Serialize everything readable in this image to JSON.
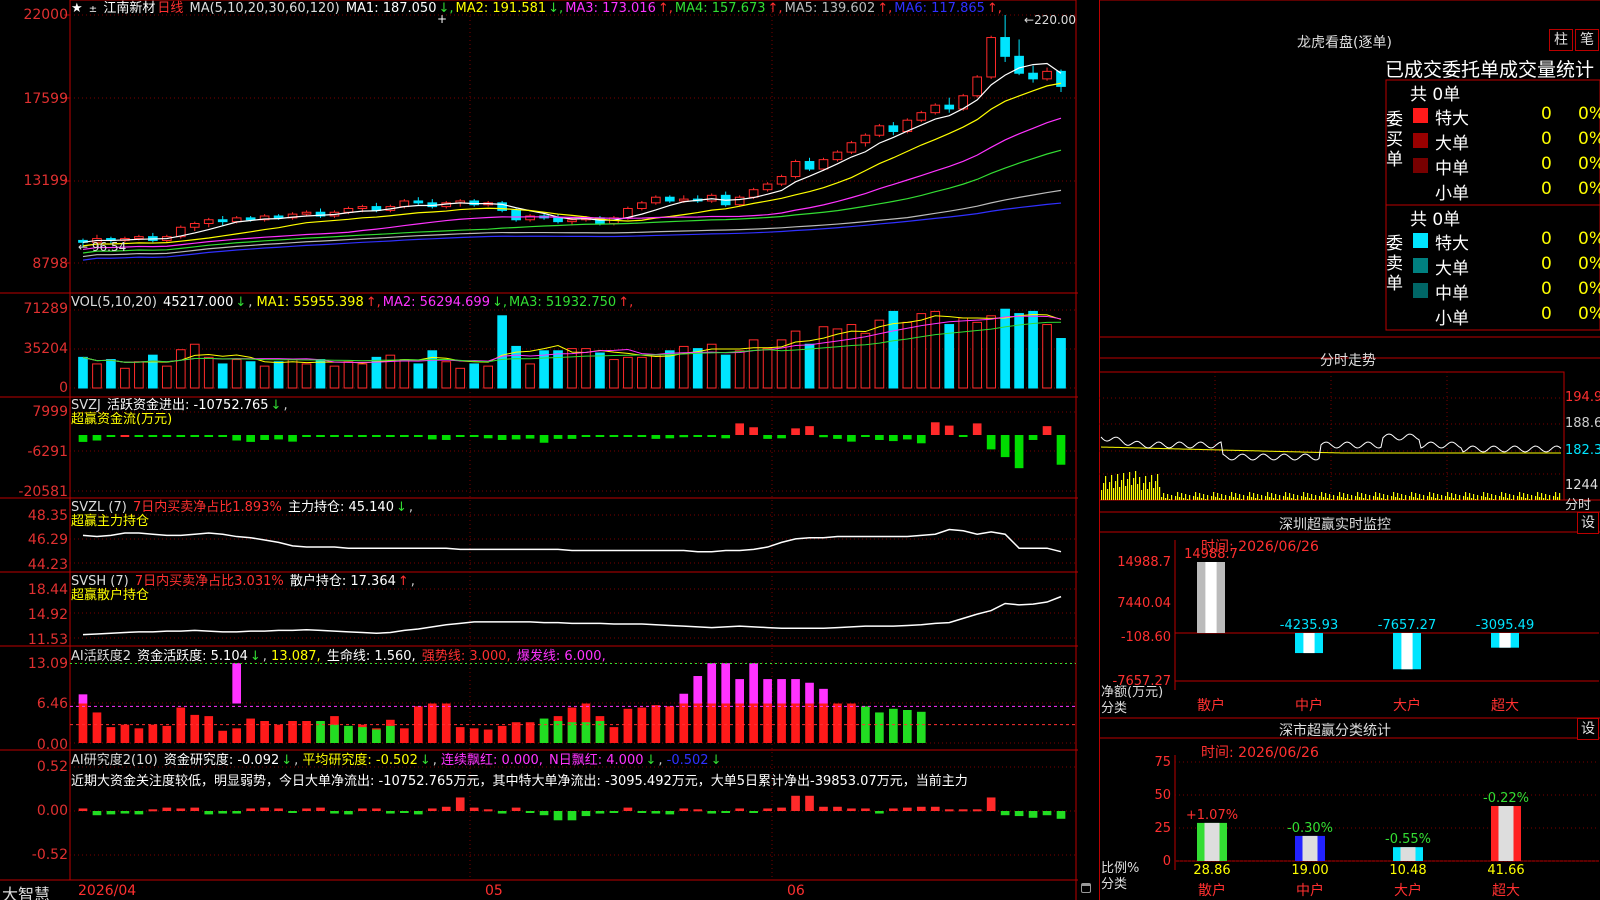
{
  "stock": {
    "name": "江南新材",
    "period": "日线"
  },
  "colors": {
    "up": "#ff2a2a",
    "down": "#00e5ff",
    "grid": "#7a0000",
    "ma1": "#ffffff",
    "ma2": "#ffff00",
    "ma3": "#ff33ff",
    "ma4": "#33dd33",
    "ma5": "#bbbbbb",
    "ma6": "#3030ff"
  },
  "main_panel": {
    "ma_label": "MA(5,10,20,30,60,120)",
    "mas": [
      {
        "label": "MA1: 187.050",
        "arrow": "↓",
        "color": "#ffffff"
      },
      {
        "label": "MA2: 191.581",
        "arrow": "↓",
        "color": "#ffff00"
      },
      {
        "label": "MA3: 173.016",
        "arrow": "↑",
        "color": "#ff33ff"
      },
      {
        "label": "MA4: 157.673",
        "arrow": "↑",
        "color": "#33dd33"
      },
      {
        "label": "MA5: 139.602",
        "arrow": "↑",
        "color": "#bbbbbb"
      },
      {
        "label": "MA6: 117.865",
        "arrow": "↑",
        "color": "#3030ff"
      }
    ],
    "yticks": [
      "22000",
      "17599",
      "13199",
      "8798"
    ],
    "hi_label": "220.00",
    "lo_label": "96.54"
  },
  "vol_panel": {
    "label": "VOL(5,10,20)",
    "value": "45217.000",
    "arrow": "↓",
    "mas": [
      {
        "label": "MA1: 55955.398",
        "arrow": "↑",
        "color": "#ffff00"
      },
      {
        "label": "MA2: 56294.699",
        "arrow": "↓",
        "color": "#ff33ff"
      },
      {
        "label": "MA3: 51932.750",
        "arrow": "↑",
        "color": "#33dd33"
      }
    ],
    "yticks": [
      "71289",
      "35204",
      "0"
    ]
  },
  "svzj_panel": {
    "label": "SVZJ",
    "subtitle": "活跃资金进出: -10752.765",
    "arrow": "↓",
    "subtitle2": "超赢资金流(万元)",
    "yticks": [
      "7999",
      "-6291",
      "-20581"
    ]
  },
  "svzl_panel": {
    "label": "SVZL (7)",
    "part1": "7日内买卖净占比1.893%",
    "part2": "主力持仓: 45.140",
    "arrow": "↓",
    "subtitle2": "超赢主力持仓",
    "yticks": [
      "48.35",
      "46.29",
      "44.23"
    ]
  },
  "svsh_panel": {
    "label": "SVSH (7)",
    "part1": "7日内买卖净占比3.031%",
    "part2": "散户持仓: 17.364",
    "arrow": "↑",
    "subtitle2": "超赢散户持仓",
    "yticks": [
      "18.44",
      "14.92",
      "11.53"
    ]
  },
  "ai1_panel": {
    "label": "AI活跃度2",
    "part1": "资金活跃度: 5.104",
    "arrow1": "↓",
    "part2": "13.087,",
    "part3": "生命线: 1.560,",
    "part4": "强势线: 3.000,",
    "part5": "爆发线: 6.000,",
    "yticks": [
      "13.09",
      "6.46",
      "0.00"
    ]
  },
  "ai2_panel": {
    "label": "AI研究度2(10)",
    "part1": "资金研究度: -0.092",
    "arrow1": "↓",
    "part2": "平均研究度: -0.502",
    "arrow2": "↓",
    "part3": "连续飘红: 0.000,",
    "part4": "N日飘红: 4.000",
    "arrow4": "↓",
    "part5": "-0.502",
    "arrow5": "↓",
    "desc": "近期大资金关注度较低，明显弱势，今日大单净流出: -10752.765万元，其中特大单净流出: -3095.492万元，大单5日累计净出-39853.07万元，当前主力",
    "yticks": [
      "0.52",
      "0.00",
      "-0.52"
    ]
  },
  "xaxis": {
    "labels": [
      "2026/04",
      "05",
      "06"
    ]
  },
  "brand": "大智慧",
  "right": {
    "lhb_title": "龙虎看盘(逐单)",
    "btn_zhu": "柱",
    "btn_bi": "笔",
    "tabs": "已成交委托单成交量统计",
    "buy_label": "委买单",
    "sell_label": "委卖单",
    "buy_total": "共 0单",
    "sell_total": "共 0单",
    "buy_rows": [
      {
        "name": "特大",
        "count": "0",
        "pct": "0%",
        "color": "#ff1a1a"
      },
      {
        "name": "大单",
        "count": "0",
        "pct": "0%",
        "color": "#990000"
      },
      {
        "name": "中单",
        "count": "0",
        "pct": "0%",
        "color": "#770000"
      },
      {
        "name": "小单",
        "count": "0",
        "pct": "0%",
        "color": ""
      }
    ],
    "sell_rows": [
      {
        "name": "特大",
        "count": "0",
        "pct": "0%",
        "color": "#00e5ff"
      },
      {
        "name": "大单",
        "count": "0",
        "pct": "0%",
        "color": "#008080"
      },
      {
        "name": "中单",
        "count": "0",
        "pct": "0%",
        "color": "#006666"
      },
      {
        "name": "小单",
        "count": "0",
        "pct": "0%",
        "color": ""
      }
    ],
    "fs_title": "分时走势",
    "fs_yticks": [
      "194.9",
      "188.6",
      "182.3",
      "1244"
    ],
    "fs_fenshi": "分时",
    "mon_title": "深圳超赢实时监控",
    "mon_btn": "设",
    "mon_time": "时间: 2026/06/26",
    "mon_yticks": [
      "14988.7",
      "7440.04",
      "-108.60",
      "-7657.27"
    ],
    "mon_ylabel": "净额(万元)",
    "mon_xlabel": "分类",
    "mon_bars": [
      {
        "cat": "散户",
        "value": 14988.7,
        "label": "14988.7"
      },
      {
        "cat": "中户",
        "value": -4235.93,
        "label": "-4235.93"
      },
      {
        "cat": "大户",
        "value": -7657.27,
        "label": "-7657.27"
      },
      {
        "cat": "超大",
        "value": -3095.49,
        "label": "-3095.49"
      }
    ],
    "cls_title": "深市超赢分类统计",
    "cls_btn": "设",
    "cls_time": "时间: 2026/06/26",
    "cls_yticks": [
      "75",
      "50",
      "25",
      "0"
    ],
    "cls_ylabel": "比例%",
    "cls_xlabel": "分类",
    "cls_bars": [
      {
        "cat": "散户",
        "value": 28.86,
        "label": "28.86",
        "delta": "+1.07%",
        "color": "#33dd33"
      },
      {
        "cat": "中户",
        "value": 19.0,
        "label": "19.00",
        "delta": "-0.30%",
        "color": "#2222ff"
      },
      {
        "cat": "大户",
        "value": 10.48,
        "label": "10.48",
        "delta": "-0.55%",
        "color": "#00e5ff"
      },
      {
        "cat": "超大",
        "value": 41.66,
        "label": "41.66",
        "delta": "-0.22%",
        "color": "#ff2222"
      }
    ]
  },
  "chart_data": {
    "type": "candlestick",
    "title": "江南新材 日线",
    "x_range": [
      "2026/04",
      "2026/06/26"
    ],
    "ylim": [
      87.98,
      220.0
    ],
    "ohlc": [
      [
        100,
        101,
        96.5,
        99
      ],
      [
        99,
        103,
        97,
        101
      ],
      [
        101,
        102,
        98,
        100
      ],
      [
        100,
        102,
        99,
        101
      ],
      [
        101,
        103,
        100,
        102
      ],
      [
        102,
        104,
        99,
        100
      ],
      [
        100,
        103,
        99,
        102
      ],
      [
        102,
        108,
        101,
        107
      ],
      [
        107,
        110,
        105,
        109
      ],
      [
        109,
        112,
        107,
        111
      ],
      [
        111,
        113,
        108,
        110
      ],
      [
        110,
        113,
        109,
        112
      ],
      [
        112,
        113,
        110,
        111
      ],
      [
        111,
        114,
        110,
        113
      ],
      [
        113,
        114,
        111,
        112
      ],
      [
        112,
        115,
        111,
        114
      ],
      [
        114,
        116,
        113,
        115
      ],
      [
        115,
        117,
        112,
        113
      ],
      [
        113,
        116,
        112,
        115
      ],
      [
        115,
        118,
        114,
        117
      ],
      [
        117,
        119,
        115,
        118
      ],
      [
        118,
        120,
        115,
        116
      ],
      [
        116,
        119,
        115,
        118
      ],
      [
        118,
        122,
        117,
        121
      ],
      [
        121,
        123,
        119,
        120
      ],
      [
        120,
        122,
        117,
        118
      ],
      [
        118,
        121,
        117,
        120
      ],
      [
        120,
        122,
        118,
        121
      ],
      [
        121,
        122,
        118,
        119
      ],
      [
        119,
        121,
        118,
        120
      ],
      [
        120,
        121,
        115,
        116
      ],
      [
        116,
        117,
        110,
        111
      ],
      [
        111,
        114,
        110,
        113
      ],
      [
        113,
        115,
        111,
        112
      ],
      [
        112,
        114,
        109,
        110
      ],
      [
        110,
        112,
        108,
        111
      ],
      [
        111,
        113,
        110,
        112
      ],
      [
        112,
        113,
        108,
        109
      ],
      [
        109,
        113,
        108,
        112
      ],
      [
        112,
        118,
        111,
        117
      ],
      [
        117,
        121,
        116,
        120
      ],
      [
        120,
        124,
        119,
        123
      ],
      [
        123,
        124,
        120,
        121
      ],
      [
        121,
        124,
        120,
        122
      ],
      [
        122,
        124,
        120,
        121
      ],
      [
        121,
        125,
        120,
        124
      ],
      [
        124,
        126,
        118,
        119
      ],
      [
        119,
        124,
        118,
        123
      ],
      [
        123,
        128,
        122,
        127
      ],
      [
        127,
        131,
        126,
        130
      ],
      [
        130,
        135,
        129,
        134
      ],
      [
        134,
        143,
        133,
        142
      ],
      [
        142,
        144,
        137,
        138
      ],
      [
        138,
        144,
        137,
        143
      ],
      [
        143,
        148,
        142,
        147
      ],
      [
        147,
        153,
        146,
        152
      ],
      [
        152,
        157,
        150,
        156
      ],
      [
        156,
        162,
        155,
        161
      ],
      [
        161,
        163,
        156,
        158
      ],
      [
        158,
        165,
        157,
        164
      ],
      [
        164,
        169,
        163,
        168
      ],
      [
        168,
        173,
        167,
        172
      ],
      [
        172,
        176,
        168,
        170
      ],
      [
        170,
        178,
        169,
        177
      ],
      [
        177,
        188,
        176,
        187
      ],
      [
        187,
        209,
        186,
        208
      ],
      [
        208,
        220,
        195,
        198
      ],
      [
        198,
        207,
        188,
        189
      ],
      [
        189,
        193,
        184,
        186
      ],
      [
        186,
        192,
        185,
        190
      ],
      [
        190,
        191,
        179,
        182
      ]
    ],
    "ma_series": {
      "MA1": [
        187.05
      ],
      "MA2": [
        191.581
      ],
      "MA3": [
        173.016
      ],
      "MA4": [
        157.673
      ],
      "MA5": [
        139.602
      ],
      "MA6": [
        117.865
      ]
    },
    "volume": [
      28000,
      22000,
      26000,
      18000,
      24000,
      30000,
      20000,
      35000,
      40000,
      28000,
      22000,
      26000,
      24000,
      20000,
      24000,
      26000,
      22000,
      26000,
      20000,
      24000,
      22000,
      28000,
      30000,
      26000,
      22000,
      34000,
      24000,
      18000,
      22000,
      20000,
      66000,
      38000,
      22000,
      34000,
      34000,
      36000,
      36000,
      32000,
      26000,
      28000,
      28000,
      30000,
      34000,
      38000,
      36000,
      40000,
      30000,
      34000,
      44000,
      36000,
      44000,
      52000,
      40000,
      56000,
      54000,
      58000,
      50000,
      62000,
      70000,
      60000,
      68000,
      70000,
      58000,
      64000,
      60000,
      66000,
      72000,
      68000,
      70000,
      58000,
      45217
    ],
    "svzj": [
      -2500,
      -2000,
      -200,
      0,
      -200,
      -100,
      -400,
      -400,
      -200,
      -400,
      -200,
      -2000,
      -2500,
      -1800,
      -1600,
      -2400,
      -200,
      -100,
      -200,
      -100,
      -100,
      -200,
      -150,
      -300,
      -200,
      -1600,
      -1800,
      -200,
      -150,
      -1200,
      -1800,
      -1600,
      -1300,
      -2800,
      -1400,
      -1400,
      -200,
      -600,
      -200,
      -300,
      -200,
      -1400,
      -1200,
      -800,
      -200,
      -500,
      -1200,
      4200,
      2800,
      -1400,
      -1200,
      2400,
      3200,
      -800,
      -1400,
      -2400,
      -200,
      -1800,
      -2200,
      -1600,
      -3000,
      4600,
      3400,
      -500,
      4200,
      -5200,
      -8000,
      -12000,
      -1800,
      3200,
      -10752
    ],
    "svzl": [
      46.6,
      46.5,
      46.6,
      46.8,
      46.8,
      46.7,
      46.6,
      46.6,
      46.7,
      46.8,
      46.7,
      46.5,
      46.4,
      46.2,
      46.0,
      45.7,
      45.6,
      45.6,
      45.6,
      45.5,
      45.5,
      45.5,
      45.5,
      45.5,
      45.5,
      45.5,
      45.5,
      45.4,
      45.4,
      45.4,
      45.4,
      45.4,
      45.4,
      45.4,
      45.4,
      45.3,
      45.3,
      45.3,
      45.3,
      45.3,
      45.3,
      45.3,
      45.3,
      45.3,
      45.2,
      45.2,
      45.3,
      45.3,
      45.4,
      45.6,
      46.0,
      46.3,
      46.4,
      46.4,
      46.5,
      46.5,
      46.5,
      46.5,
      46.5,
      46.5,
      46.6,
      46.7,
      47.1,
      47.0,
      46.7,
      46.9,
      46.7,
      45.5,
      45.5,
      45.5,
      45.2,
      45.14
    ],
    "svsh": [
      12.0,
      12.1,
      12.2,
      12.3,
      12.4,
      12.4,
      12.5,
      12.5,
      12.6,
      12.5,
      12.4,
      12.4,
      12.5,
      12.5,
      12.6,
      12.6,
      12.7,
      12.6,
      12.5,
      12.4,
      12.3,
      12.2,
      12.3,
      12.6,
      12.8,
      13.1,
      13.4,
      13.6,
      13.8,
      13.8,
      13.8,
      13.8,
      13.8,
      13.7,
      13.7,
      13.6,
      13.6,
      13.6,
      13.5,
      13.5,
      13.5,
      13.4,
      13.3,
      13.2,
      13.1,
      13.0,
      13.1,
      13.2,
      13.1,
      13.0,
      12.9,
      12.9,
      12.9,
      12.9,
      13.0,
      13.1,
      13.2,
      13.2,
      13.2,
      13.3,
      13.4,
      13.6,
      13.7,
      14.3,
      14.9,
      15.4,
      16.4,
      16.2,
      16.3,
      16.6,
      17.364
    ],
    "ai1_red": [
      6.5,
      5.0,
      2.6,
      3.0,
      2.4,
      3.0,
      2.8,
      5.8,
      4.6,
      4.4,
      2.0,
      2.4,
      4.0,
      3.6,
      3.0,
      3.6,
      3.6,
      3.4,
      4.4,
      2.4,
      3.0,
      2.4,
      3.8,
      2.4,
      6.0,
      6.46,
      6.46,
      2.6,
      2.4,
      2.2,
      2.8,
      3.4,
      3.4,
      2.6,
      4.4,
      5.8,
      6.46,
      4.4,
      2.6,
      5.6,
      5.8,
      6.2,
      6.0,
      6.46,
      6.46,
      6.46,
      6.46,
      6.46,
      6.46,
      6.46,
      6.46,
      6.46,
      6.46,
      6.46,
      6.46,
      6.46,
      0,
      0,
      0,
      0,
      0
    ],
    "ai1_mag": [
      1.5,
      0,
      0,
      0,
      0,
      0,
      0,
      0,
      0,
      0,
      0,
      6.6,
      0,
      0,
      0,
      0,
      0,
      0,
      0,
      0,
      0,
      0,
      0,
      0,
      0,
      0,
      0,
      0,
      0,
      0,
      0,
      0,
      0,
      0,
      0,
      0,
      0,
      0,
      0,
      0,
      0,
      0,
      0,
      1.6,
      4.5,
      6.6,
      6.6,
      4.0,
      6.6,
      4.0,
      4.0,
      4.0,
      3.4,
      2.4,
      0,
      0,
      0,
      0,
      0,
      0,
      0
    ],
    "ai1_green": [
      0,
      0,
      0,
      0,
      0,
      0,
      0,
      0,
      0,
      0,
      0,
      0,
      0,
      0,
      0,
      0,
      0,
      3.6,
      3.0,
      2.8,
      2.6,
      2.2,
      2.8,
      0,
      0,
      0,
      0,
      0,
      0,
      0,
      0,
      0,
      0,
      4.0,
      3.6,
      3.4,
      3.4,
      3.6,
      0,
      0,
      0,
      0,
      0,
      0,
      0,
      0,
      0,
      0,
      0,
      0,
      0,
      0,
      0,
      0,
      0,
      0,
      6.0,
      5.0,
      5.6,
      5.4,
      5.104
    ],
    "ai2": [
      0.03,
      -0.05,
      -0.04,
      -0.03,
      -0.04,
      0.02,
      0.04,
      0.03,
      0.04,
      -0.04,
      -0.03,
      -0.03,
      0.03,
      0.04,
      0.03,
      -0.02,
      0.03,
      0.04,
      -0.03,
      -0.04,
      0.03,
      0.03,
      -0.03,
      -0.02,
      -0.04,
      0.03,
      0.05,
      0.16,
      0.04,
      0.02,
      -0.03,
      0.04,
      -0.02,
      -0.05,
      -0.11,
      -0.11,
      -0.06,
      -0.03,
      -0.02,
      0.04,
      -0.02,
      -0.03,
      -0.04,
      0.03,
      0.02,
      -0.03,
      -0.02,
      0.03,
      -0.02,
      0.03,
      0.04,
      0.18,
      0.18,
      0.05,
      0.05,
      0.03,
      0.03,
      -0.03,
      0.03,
      0.04,
      0.05,
      0.05,
      0.02,
      0.02,
      0.02,
      0.16,
      -0.05,
      -0.06,
      -0.08,
      -0.05,
      -0.092
    ]
  }
}
